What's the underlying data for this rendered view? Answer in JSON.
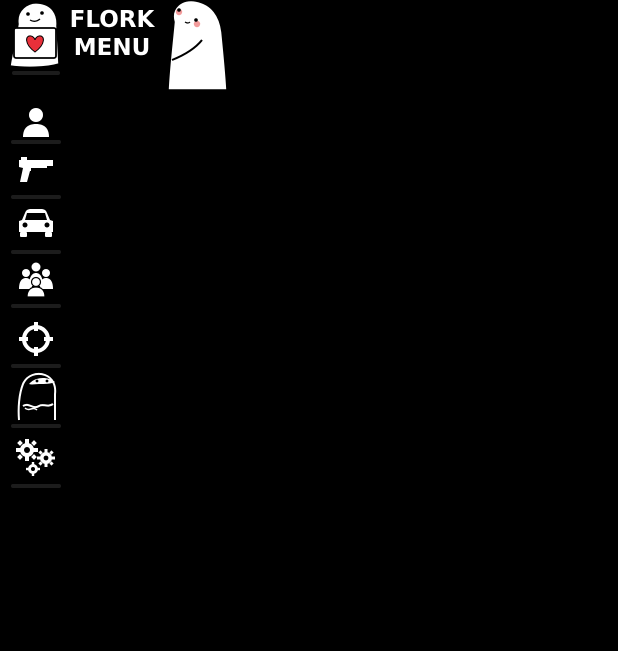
{
  "header": {
    "title_line1": "FLORK",
    "title_line2": "MENU",
    "logo_left": "flork-heart-mascot",
    "logo_right": "flork-blush-mascot"
  },
  "sidebar": {
    "items": [
      {
        "id": "player",
        "icon": "user-icon"
      },
      {
        "id": "weapons",
        "icon": "pistol-icon"
      },
      {
        "id": "vehicles",
        "icon": "car-icon"
      },
      {
        "id": "online",
        "icon": "people-group-icon"
      },
      {
        "id": "aimbot",
        "icon": "crosshair-icon"
      },
      {
        "id": "flork",
        "icon": "flork-face-icon"
      },
      {
        "id": "settings",
        "icon": "gears-icon"
      }
    ]
  },
  "colors": {
    "background": "#000000",
    "icon": "#ffffff",
    "divider": "#1c1c1c",
    "heart": "#e8303a",
    "blush": "#f08a8a"
  }
}
